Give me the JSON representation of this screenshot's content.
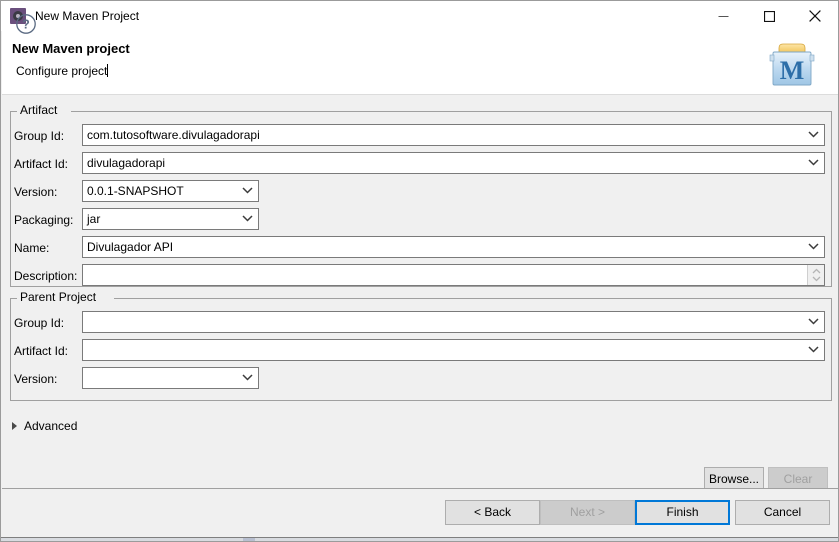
{
  "window": {
    "title": "New Maven Project",
    "icon": "maven-gear-icon",
    "controls": {
      "minimize": "minimize-icon",
      "maximize": "maximize-icon",
      "close": "close-icon"
    }
  },
  "header": {
    "title": "New Maven project",
    "subtitle": "Configure project",
    "logo": "maven-folder-logo"
  },
  "artifact": {
    "legend": "Artifact",
    "fields": [
      {
        "label": "Group Id:",
        "value": "com.tutosoftware.divulagadorapi",
        "type": "combo",
        "width": "long"
      },
      {
        "label": "Artifact Id:",
        "value": "divulagadorapi",
        "type": "combo",
        "width": "long"
      },
      {
        "label": "Version:",
        "value": "0.0.1-SNAPSHOT",
        "type": "combo",
        "width": "short"
      },
      {
        "label": "Packaging:",
        "value": "jar",
        "type": "combo",
        "width": "short"
      },
      {
        "label": "Name:",
        "value": "Divulagador API",
        "type": "combo",
        "width": "long"
      },
      {
        "label": "Description:",
        "value": "",
        "type": "textarea",
        "width": "long"
      }
    ]
  },
  "parent": {
    "legend": "Parent Project",
    "fields": [
      {
        "label": "Group Id:",
        "value": "",
        "type": "combo",
        "width": "long"
      },
      {
        "label": "Artifact Id:",
        "value": "",
        "type": "combo",
        "width": "long"
      },
      {
        "label": "Version:",
        "value": "",
        "type": "combo",
        "width": "short"
      }
    ],
    "browse_label": "Browse...",
    "clear_label": "Clear",
    "clear_enabled": false
  },
  "advanced": {
    "label": "Advanced",
    "expanded": false,
    "icon": "chevron-right-icon"
  },
  "buttonbar": {
    "help_icon": "help-question-icon",
    "back_label": "< Back",
    "next_label": "Next >",
    "next_enabled": false,
    "finish_label": "Finish",
    "finish_default": true,
    "cancel_label": "Cancel"
  },
  "colors": {
    "dialog_background": "#f0f0f0",
    "header_background": "#ffffff",
    "field_background": "#ffffff",
    "field_border": "#7a7a7a",
    "group_border": "#a0a0a0",
    "accent_focus": "#0078d7",
    "disabled_text": "#a0a0a0",
    "maven_purple": "#6a4f7d",
    "maven_blue": "#2c6ea8"
  }
}
